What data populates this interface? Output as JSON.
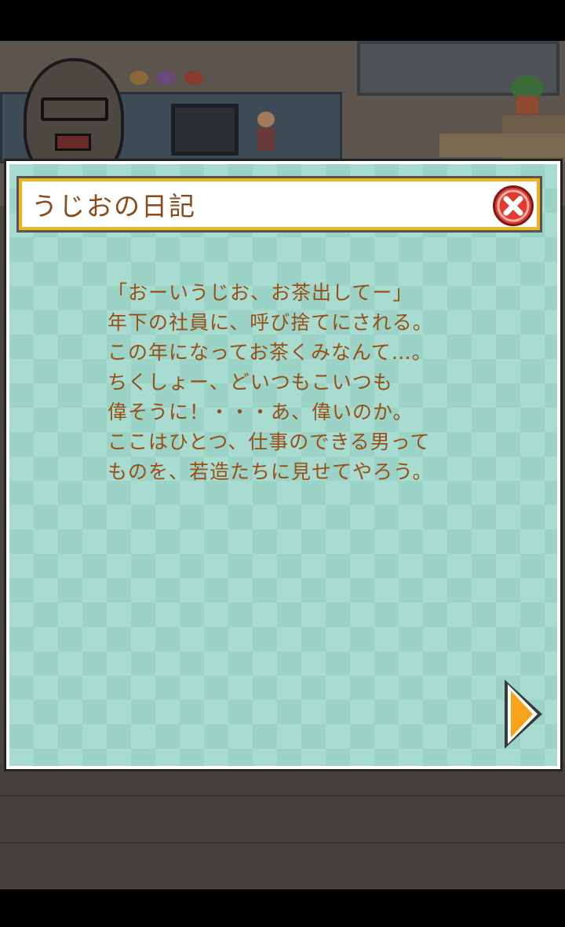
{
  "dialog": {
    "title": "うじおの日記",
    "lines": [
      "「おーいうじお、お茶出してー」",
      "年下の社員に、呼び捨てにされる。",
      "この年になってお茶くみなんて…。",
      "ちくしょー、どいつもこいつも",
      "偉そうに！・・・あ、偉いのか。",
      "ここはひとつ、仕事のできる男って",
      "ものを、若造たちに見せてやろう。"
    ]
  },
  "icons": {
    "close": "close-icon",
    "next": "next-arrow-icon"
  },
  "colors": {
    "title_text": "#8a4a1a",
    "body_text": "#9a4e14",
    "title_border": "#f2b21a",
    "dialog_bg": "#a8dcd1",
    "close_button": "#e23b2e",
    "next_arrow": "#f7a21b"
  }
}
